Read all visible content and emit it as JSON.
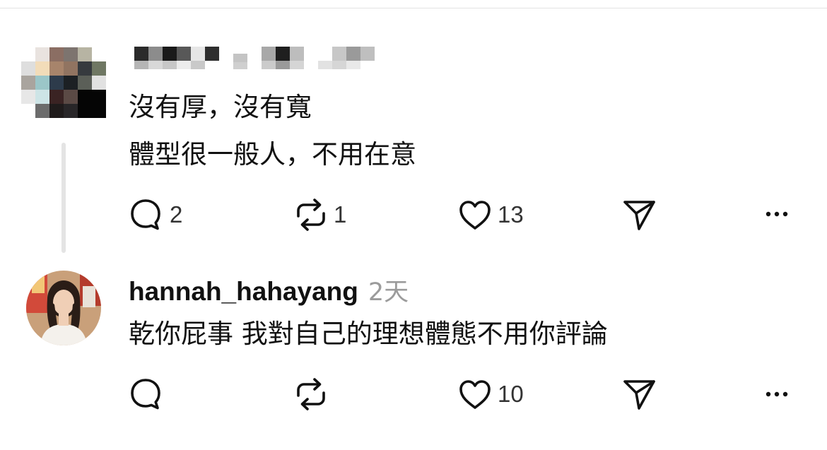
{
  "post1": {
    "lines": [
      "沒有厚，沒有寬",
      "體型很一般人，不用在意"
    ],
    "replies": "2",
    "reposts": "1",
    "likes": "13"
  },
  "post2": {
    "username": "hannah_hahayang",
    "time": "2天",
    "text": "乾你屁事 我對自己的理想體態不用你評論",
    "likes": "10"
  },
  "icons": {
    "reply": "reply-icon",
    "repost": "repost-icon",
    "like": "heart-icon",
    "share": "share-icon",
    "more": "more-icon"
  }
}
